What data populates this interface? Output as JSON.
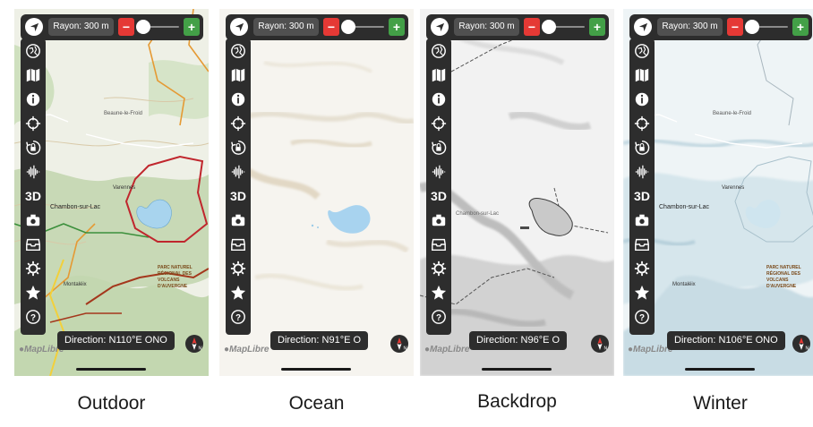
{
  "panels": [
    {
      "caption": "Outdoor",
      "radius_label": "Rayon: 300 m",
      "direction": "Direction: N110°E  ONO",
      "attribution": "MapLibre",
      "place_labels": [
        "Beaune-le-Froid",
        "Varennes",
        "Chambon-sur-Lac",
        "Montaléix",
        "PARC NATUREL RÉGIONAL DES VOLCANS D'AUVERGNE"
      ]
    },
    {
      "caption": "Ocean",
      "radius_label": "Rayon: 300 m",
      "direction": "Direction: N91°E  O",
      "attribution": "MapLibre",
      "place_labels": []
    },
    {
      "caption": "Backdrop",
      "radius_label": "Rayon: 300 m",
      "direction": "Direction: N96°E  O",
      "attribution": "MapLibre",
      "place_labels": [
        "Chambon-sur-Lac"
      ]
    },
    {
      "caption": "Winter",
      "radius_label": "Rayon: 300 m",
      "direction": "Direction: N106°E  ONO",
      "attribution": "MapLibre",
      "place_labels": [
        "Beaune-le-Froid",
        "Varennes",
        "Chambon-sur-Lac",
        "Montaléix",
        "PARC NATUREL RÉGIONAL DES VOLCANS D'AUVERGNE"
      ]
    }
  ],
  "controls": {
    "minus_label": "−",
    "plus_label": "+",
    "three_d_label": "3D",
    "compass_letter": "N"
  },
  "sidebar_icons": [
    "globe-icon",
    "map-icon",
    "info-icon",
    "crosshair-icon",
    "rotation-lock-icon",
    "audio-wave-icon",
    "3d-toggle",
    "camera-icon",
    "archive-tray-icon",
    "gear-icon",
    "star-icon",
    "help-icon"
  ],
  "colors": {
    "toolbar_bg": "#2d2d2d",
    "minus_red": "#e53935",
    "plus_green": "#43a047",
    "outdoor_land": "#eef0e6",
    "outdoor_forest": "#c5d9b4",
    "outdoor_lake": "#a8d4ee",
    "ocean_land": "#f6f4ef",
    "ocean_lake": "#a8d3ef",
    "backdrop_land": "#f2f2f2",
    "backdrop_lake": "#c9c9c9",
    "winter_land": "#eef4f6",
    "winter_relief": "#c6dbe5"
  }
}
